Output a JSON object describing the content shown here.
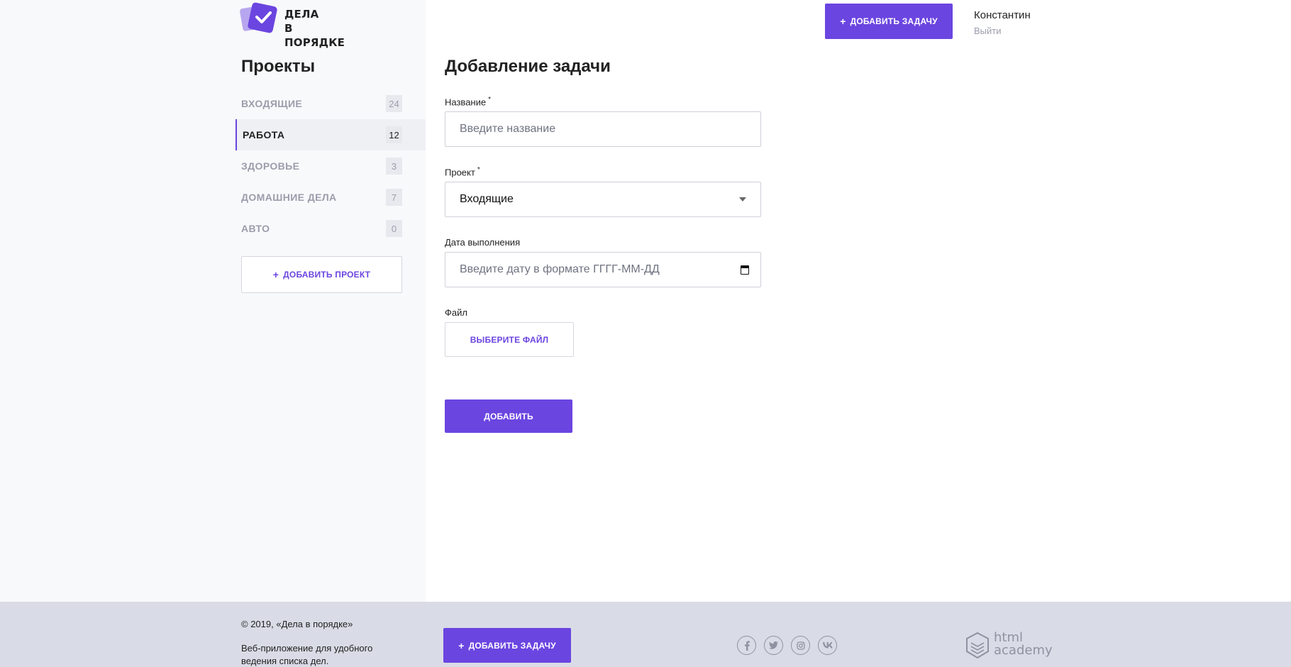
{
  "brand": {
    "line1": "ДЕЛА",
    "line2": "В ПОРЯДКЕ",
    "accent": "#6b45e0"
  },
  "header": {
    "add_task_label": "ДОБАВИТЬ ЗАДАЧУ",
    "user_name": "Константин",
    "logout_label": "Выйти"
  },
  "sidebar": {
    "title": "Проекты",
    "projects": [
      {
        "label": "ВХОДЯЩИЕ",
        "count": "24",
        "active": false
      },
      {
        "label": "РАБОТА",
        "count": "12",
        "active": true
      },
      {
        "label": "ЗДОРОВЬЕ",
        "count": "3",
        "active": false
      },
      {
        "label": "ДОМАШНИЕ ДЕЛА",
        "count": "7",
        "active": false
      },
      {
        "label": "АВТО",
        "count": "0",
        "active": false
      }
    ],
    "add_project_label": "ДОБАВИТЬ ПРОЕКТ"
  },
  "form": {
    "title": "Добавление задачи",
    "name_label": "Название",
    "name_required": "*",
    "name_placeholder": "Введите название",
    "project_label": "Проект",
    "project_required": "*",
    "project_value": "Входящие",
    "date_label": "Дата выполнения",
    "date_placeholder": "Введите дату в формате ГГГГ-ММ-ДД",
    "file_label": "Файл",
    "file_button": "ВЫБЕРИТЕ ФАЙЛ",
    "submit_label": "ДОБАВИТЬ"
  },
  "footer": {
    "copyright": "© 2019, «Дела в порядке»",
    "description": "Веб-приложение для удобного ведения списка дел.",
    "add_task_label": "ДОБАВИТЬ ЗАДАЧУ",
    "socials": [
      "facebook-icon",
      "twitter-icon",
      "instagram-icon",
      "vk-icon"
    ],
    "academy": {
      "line1": "html",
      "line2": "academy"
    }
  }
}
